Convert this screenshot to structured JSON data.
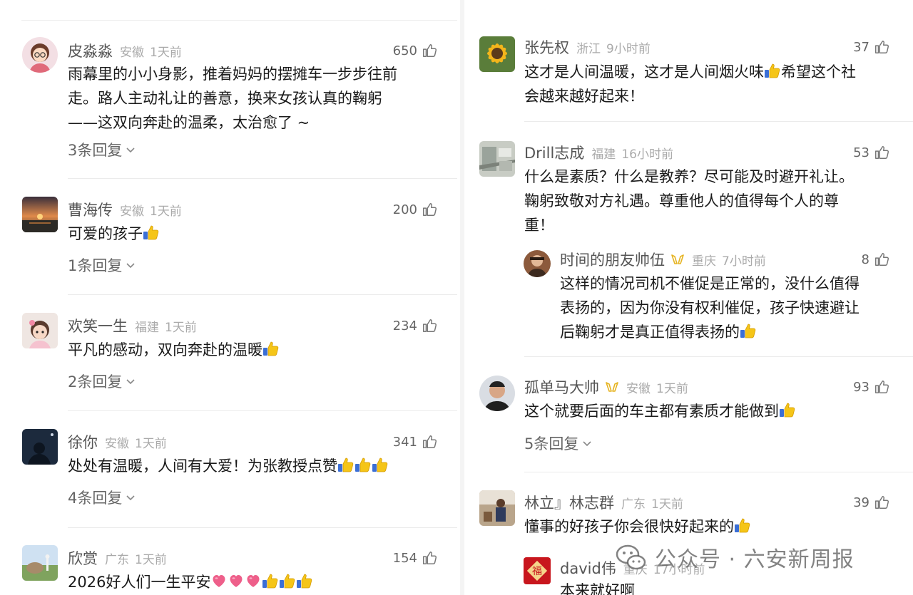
{
  "left_comments": [
    {
      "name": "皮淼淼",
      "region": "安徽",
      "time": "1天前",
      "likes": "650",
      "text": [
        "雨幕里的小小身影，推着妈妈的摆摊车一步步往前",
        "走。路人主动礼让的善意，换来女孩认真的鞠躬",
        "——这双向奔赴的温柔，太治愈了 ~"
      ],
      "replies": "3条回复"
    },
    {
      "name": "曹海传",
      "region": "安徽",
      "time": "1天前",
      "likes": "200",
      "text": "可爱的孩子",
      "replies": "1条回复"
    },
    {
      "name": "欢笑一生",
      "region": "福建",
      "time": "1天前",
      "likes": "234",
      "text": "平凡的感动，双向奔赴的温暖",
      "replies": "2条回复"
    },
    {
      "name": "徐你",
      "region": "安徽",
      "time": "1天前",
      "likes": "341",
      "text": "处处有温暖，人间有大爱！为张教授点赞",
      "replies": "4条回复"
    },
    {
      "name": "欣赏",
      "region": "广东",
      "time": "1天前",
      "likes": "154",
      "text": "2026好人们一生平安"
    }
  ],
  "right_comments": [
    {
      "name": "张先权",
      "region": "浙江",
      "time": "9小时前",
      "likes": "37",
      "text": [
        "这才是人间温暖，这才是人间烟火味",
        "希望这个社",
        "会越来越好起来！"
      ]
    },
    {
      "name": "Drill志成",
      "region": "福建",
      "time": "16小时前",
      "likes": "53",
      "text": [
        "什么是素质？什么是教养？尽可能及时避开礼让。",
        "鞠躬致敬对方礼遇。尊重他人的值得每个人的尊",
        "重！"
      ]
    },
    {
      "name": "时间的朋友帅伍",
      "region": "重庆",
      "time": "7小时前",
      "likes": "8",
      "text": [
        "这样的情况司机不催促是正常的，没什么值得",
        "表扬的，因为你没有权利催促，孩子快速避让",
        "后鞠躬才是真正值得表扬的"
      ]
    },
    {
      "name": "孤单马大帅",
      "region": "安徽",
      "time": "1天前",
      "likes": "93",
      "text": "这个就要后面的车主都有素质才能做到",
      "replies": "5条回复"
    },
    {
      "name": "林立』林志群",
      "region": "广东",
      "time": "1天前",
      "likes": "39",
      "text": "懂事的好孩子你会很快好起来的"
    },
    {
      "name": "david伟",
      "region": "重庆",
      "time": "17小时前",
      "text": "本来就好啊"
    }
  ],
  "watermark": {
    "label": "公众号 · 六安新周报"
  },
  "colors": {
    "name": "#555555",
    "meta": "#aaaaaa",
    "text": "#1a1a1a",
    "thumb_emoji": "#f5c518",
    "heart": "#ee5f8a"
  }
}
